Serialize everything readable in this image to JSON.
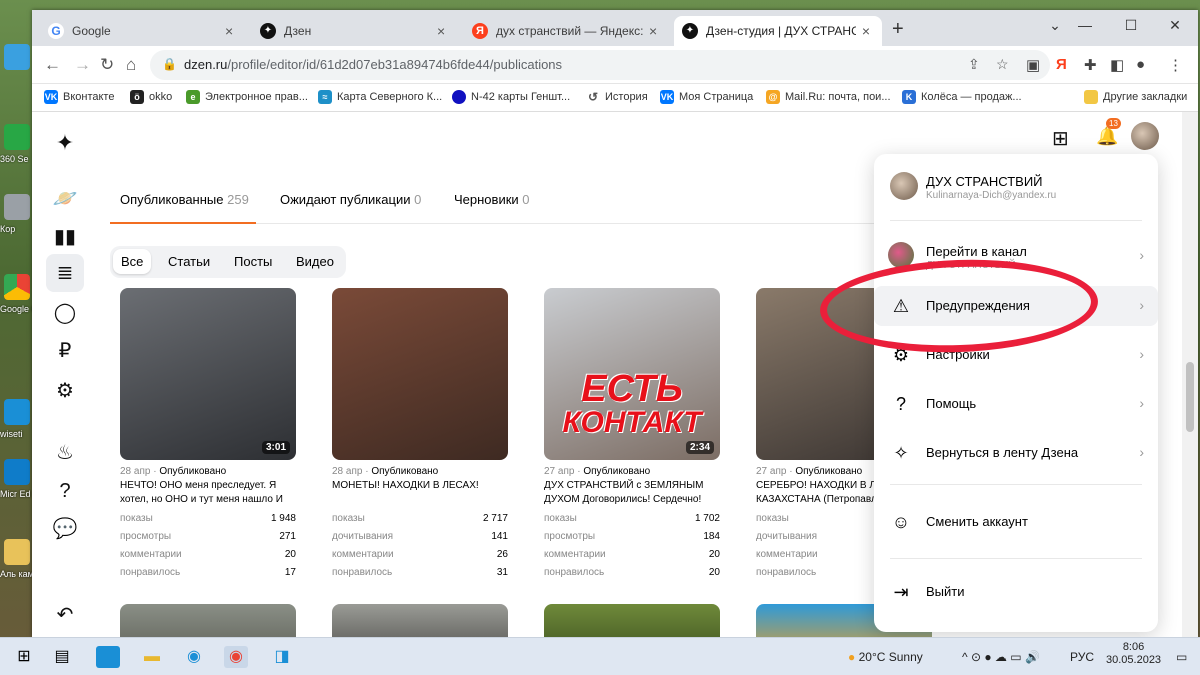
{
  "browser": {
    "tabs": [
      {
        "title": "Google",
        "color": "#4285f4",
        "glyph": "G"
      },
      {
        "title": "Дзен",
        "color": "#111111",
        "glyph": "✦"
      },
      {
        "title": "дух странствий — Яндекс: нашё",
        "color": "#fc3f1d",
        "glyph": "Я"
      },
      {
        "title": "Дзен-студия | ДУХ СТРАНСТВИЙ",
        "color": "#111111",
        "glyph": "✦"
      }
    ],
    "url_host": "dzen.ru",
    "url_path": "/profile/editor/id/61d2d07eb31a89474b6fde44/publications",
    "bookmarks": [
      {
        "label": "Вконтакте",
        "color": "#0077ff",
        "glyph": "VK"
      },
      {
        "label": "okko",
        "color": "#222222",
        "glyph": "ö"
      },
      {
        "label": "Электронное прав...",
        "color": "#4a9a2a",
        "glyph": "e"
      },
      {
        "label": "Карта Северного К...",
        "color": "#1e90c8",
        "glyph": "≈"
      },
      {
        "label": "N-42 карты Геншт...",
        "color": "#1010c0",
        "glyph": "●"
      },
      {
        "label": "История",
        "color": "#777777",
        "glyph": "↺"
      },
      {
        "label": "Моя Страница",
        "color": "#0077ff",
        "glyph": "VK"
      },
      {
        "label": "Mail.Ru: почта, пои...",
        "color": "#f5a623",
        "glyph": "@"
      },
      {
        "label": "Колёса — продаж...",
        "color": "#2a6fd6",
        "glyph": "K"
      }
    ],
    "other_bookmarks": "Другие закладки"
  },
  "studio": {
    "tabs": [
      {
        "label": "Опубликованные",
        "count": "259"
      },
      {
        "label": "Ожидают публикации",
        "count": "0"
      },
      {
        "label": "Черновики",
        "count": "0"
      }
    ],
    "filters": [
      "Все",
      "Статьи",
      "Посты",
      "Видео"
    ],
    "cards": [
      {
        "date": "28 апр",
        "status": "Опубликовано",
        "title": "НЕЧТО! ОНО меня преследует. Я хотел, но ОНО и тут меня нашло И в...",
        "duration": "3:01",
        "stats": [
          [
            "показы",
            "1 948"
          ],
          [
            "просмотры",
            "271"
          ],
          [
            "комментарии",
            "20"
          ],
          [
            "понравилось",
            "17"
          ]
        ],
        "c1": "#6b6e73",
        "c2": "#2d2f33"
      },
      {
        "date": "28 апр",
        "status": "Опубликовано",
        "title": "МОНЕТЫ! НАХОДКИ В ЛЕСАХ!",
        "duration": "",
        "stats": [
          [
            "показы",
            "2 717"
          ],
          [
            "дочитывания",
            "141"
          ],
          [
            "комментарии",
            "26"
          ],
          [
            "понравилось",
            "31"
          ]
        ],
        "c1": "#7a4a38",
        "c2": "#3e2a22"
      },
      {
        "date": "27 апр",
        "status": "Опубликовано",
        "title": "ДУХ СТРАНСТВИЙ с ЗЕМЛЯНЫМ ДУХОМ Договорились! Сердечно! (С...",
        "duration": "2:34",
        "stats": [
          [
            "показы",
            "1 702"
          ],
          [
            "просмотры",
            "184"
          ],
          [
            "комментарии",
            "20"
          ],
          [
            "понравилось",
            "20"
          ]
        ],
        "c1": "#c9ccd0",
        "c2": "#7c6d64"
      },
      {
        "date": "27 апр",
        "status": "Опубликовано",
        "title": "СЕРЕБРО! НАХОДКИ В ЛЕСАХ КАЗАХСТАНА (Петропавловск)",
        "duration": "",
        "stats": [
          [
            "показы",
            ""
          ],
          [
            "дочитывания",
            ""
          ],
          [
            "комментарии",
            ""
          ],
          [
            "понравилось",
            ""
          ]
        ],
        "c1": "#8a7a6a",
        "c2": "#3a3431"
      }
    ],
    "overlay_text": [
      "ЕСТЬ",
      "КОНТАКТ"
    ]
  },
  "account_menu": {
    "name": "ДУХ СТРАНСТВИЙ",
    "email": "Kulinarnaya-Dich@yandex.ru",
    "notifications": "13",
    "items": [
      {
        "label": "Перейти в канал",
        "sub": "ДУХ СТРАНСТВИЙ",
        "icon": "avatar"
      },
      {
        "label": "Предупреждения",
        "icon": "warning-icon"
      },
      {
        "label": "Настройки",
        "icon": "gear-icon"
      },
      {
        "label": "Помощь",
        "icon": "help-icon"
      },
      {
        "label": "Вернуться в ленту Дзена",
        "icon": "sparkle-icon"
      },
      {
        "label": "Сменить аккаунт",
        "icon": "account-icon"
      },
      {
        "label": "Выйти",
        "icon": "logout-icon"
      }
    ]
  },
  "desktop_icons": [
    "360 Se",
    "Кор",
    "Google Chr",
    "wiseti",
    "Micr Ed",
    "Аль кам"
  ],
  "taskbar": {
    "weather": "20°C  Sunny",
    "lang": "РУС",
    "time": "8:06",
    "date": "30.05.2023"
  }
}
